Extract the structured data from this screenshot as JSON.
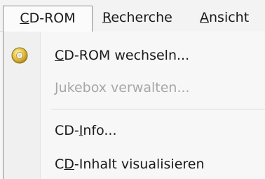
{
  "menubar": {
    "items": [
      {
        "accel": "C",
        "rest": "D-ROM"
      },
      {
        "accel": "R",
        "rest": "echerche"
      },
      {
        "accel": "A",
        "rest": "nsicht"
      }
    ]
  },
  "dropdown": {
    "items": [
      {
        "icon": "cd-icon",
        "pre": "",
        "accel": "C",
        "rest": "D-ROM wechseln...",
        "enabled": true
      },
      {
        "pre": "",
        "accel": "J",
        "rest": "ukebox verwalten...",
        "enabled": false
      },
      {
        "pre": "CD-",
        "accel": "I",
        "rest": "nfo...",
        "enabled": true
      },
      {
        "pre": "C",
        "accel": "D",
        "rest": "-Inhalt visualisieren",
        "enabled": true
      }
    ]
  },
  "colors": {
    "menu_background": "#f7f7f7",
    "text": "#1a1a1a",
    "disabled_text": "#a7a7a7",
    "icon_gold": "#d9b43a"
  }
}
